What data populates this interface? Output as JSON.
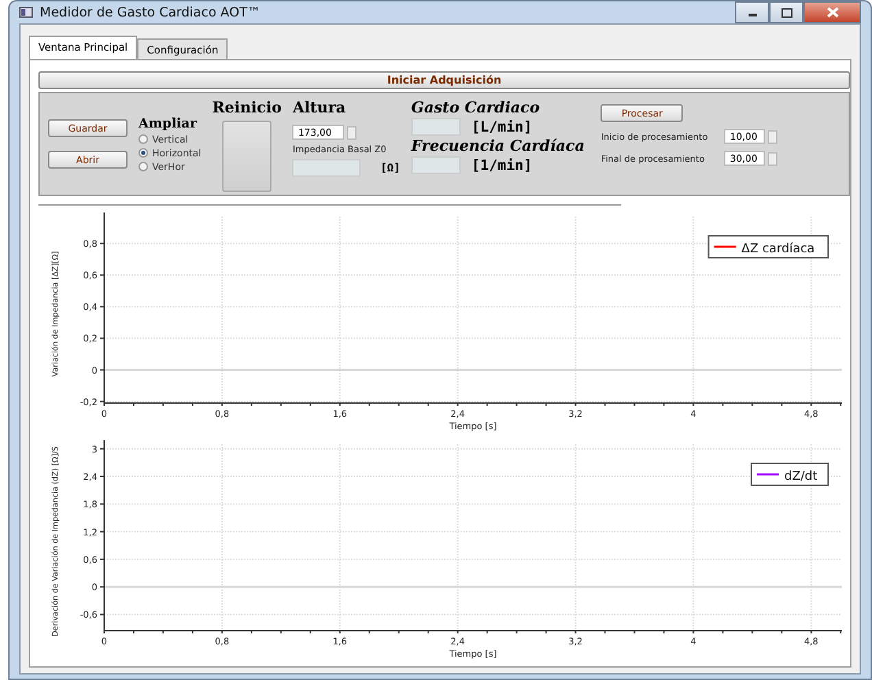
{
  "window": {
    "title": "Medidor de Gasto Cardiaco AOT™"
  },
  "tabs": [
    {
      "label": "Ventana Principal",
      "selected": true
    },
    {
      "label": "Configuración",
      "selected": false
    }
  ],
  "start_button": "Iniciar Adquisición",
  "file_buttons": [
    "Guardar",
    "Abrir"
  ],
  "zoom": {
    "title": "Ampliar",
    "options": [
      {
        "label": "Vertical",
        "selected": false
      },
      {
        "label": "Horizontal",
        "selected": true
      },
      {
        "label": "VerHor",
        "selected": false
      }
    ]
  },
  "reset": {
    "title": "Reinicio"
  },
  "height": {
    "title": "Altura",
    "value": "173,00",
    "impedance_label": "Impedancia Basal Z0",
    "impedance_unit": "[Ω]"
  },
  "results": [
    {
      "title": "Gasto Cardiaco",
      "unit": "[L/min]"
    },
    {
      "title": "Frecuencia Cardíaca",
      "unit": "[1/min]"
    }
  ],
  "processing": {
    "button": "Procesar",
    "fields": [
      {
        "label": "Inicio de procesamiento",
        "value": "10,00"
      },
      {
        "label": "Final de procesamiento",
        "value": "30,00"
      }
    ]
  },
  "charts": [
    {
      "chart_data": {
        "type": "line",
        "grid": true,
        "xlabel": "Tiempo [s]",
        "ylabel": "Variación de Impedancia [ΔZ][Ω]",
        "ylim": [
          -0.21,
          0.97
        ],
        "categories": [
          "0",
          "0,8",
          "1,6",
          "2,4",
          "3,2",
          "4",
          "4,8"
        ],
        "yticks": [
          {
            "value": -0.2,
            "label": "-0,2"
          },
          {
            "value": 0,
            "label": "0"
          },
          {
            "value": 0.2,
            "label": "0,2"
          },
          {
            "value": 0.4,
            "label": "0,4"
          },
          {
            "value": 0.6,
            "label": "0,6"
          },
          {
            "value": 0.8,
            "label": "0,8"
          }
        ],
        "series": [
          {
            "name": "ΔZ cardíaca",
            "color": "#ff0000",
            "values": [
              null,
              null,
              null,
              null,
              null,
              null,
              null
            ]
          }
        ]
      }
    },
    {
      "chart_data": {
        "type": "line",
        "grid": true,
        "xlabel": "Tiempo [s]",
        "ylabel": "Derivación de Variación de Impedancia (dZ) [Ω]/S",
        "ylim": [
          -0.95,
          3.1
        ],
        "categories": [
          "0",
          "0,8",
          "1,6",
          "2,4",
          "3,2",
          "4",
          "4,8"
        ],
        "yticks": [
          {
            "value": -0.6,
            "label": "-0,6"
          },
          {
            "value": 0,
            "label": "0"
          },
          {
            "value": 0.6,
            "label": "0,6"
          },
          {
            "value": 1.2,
            "label": "1,2"
          },
          {
            "value": 1.8,
            "label": "1,8"
          },
          {
            "value": 2.4,
            "label": "2,4"
          },
          {
            "value": 3,
            "label": "3"
          }
        ],
        "series": [
          {
            "name": "dZ/dt",
            "color": "#a000ff",
            "values": [
              null,
              null,
              null,
              null,
              null,
              null,
              null
            ]
          }
        ]
      }
    }
  ]
}
